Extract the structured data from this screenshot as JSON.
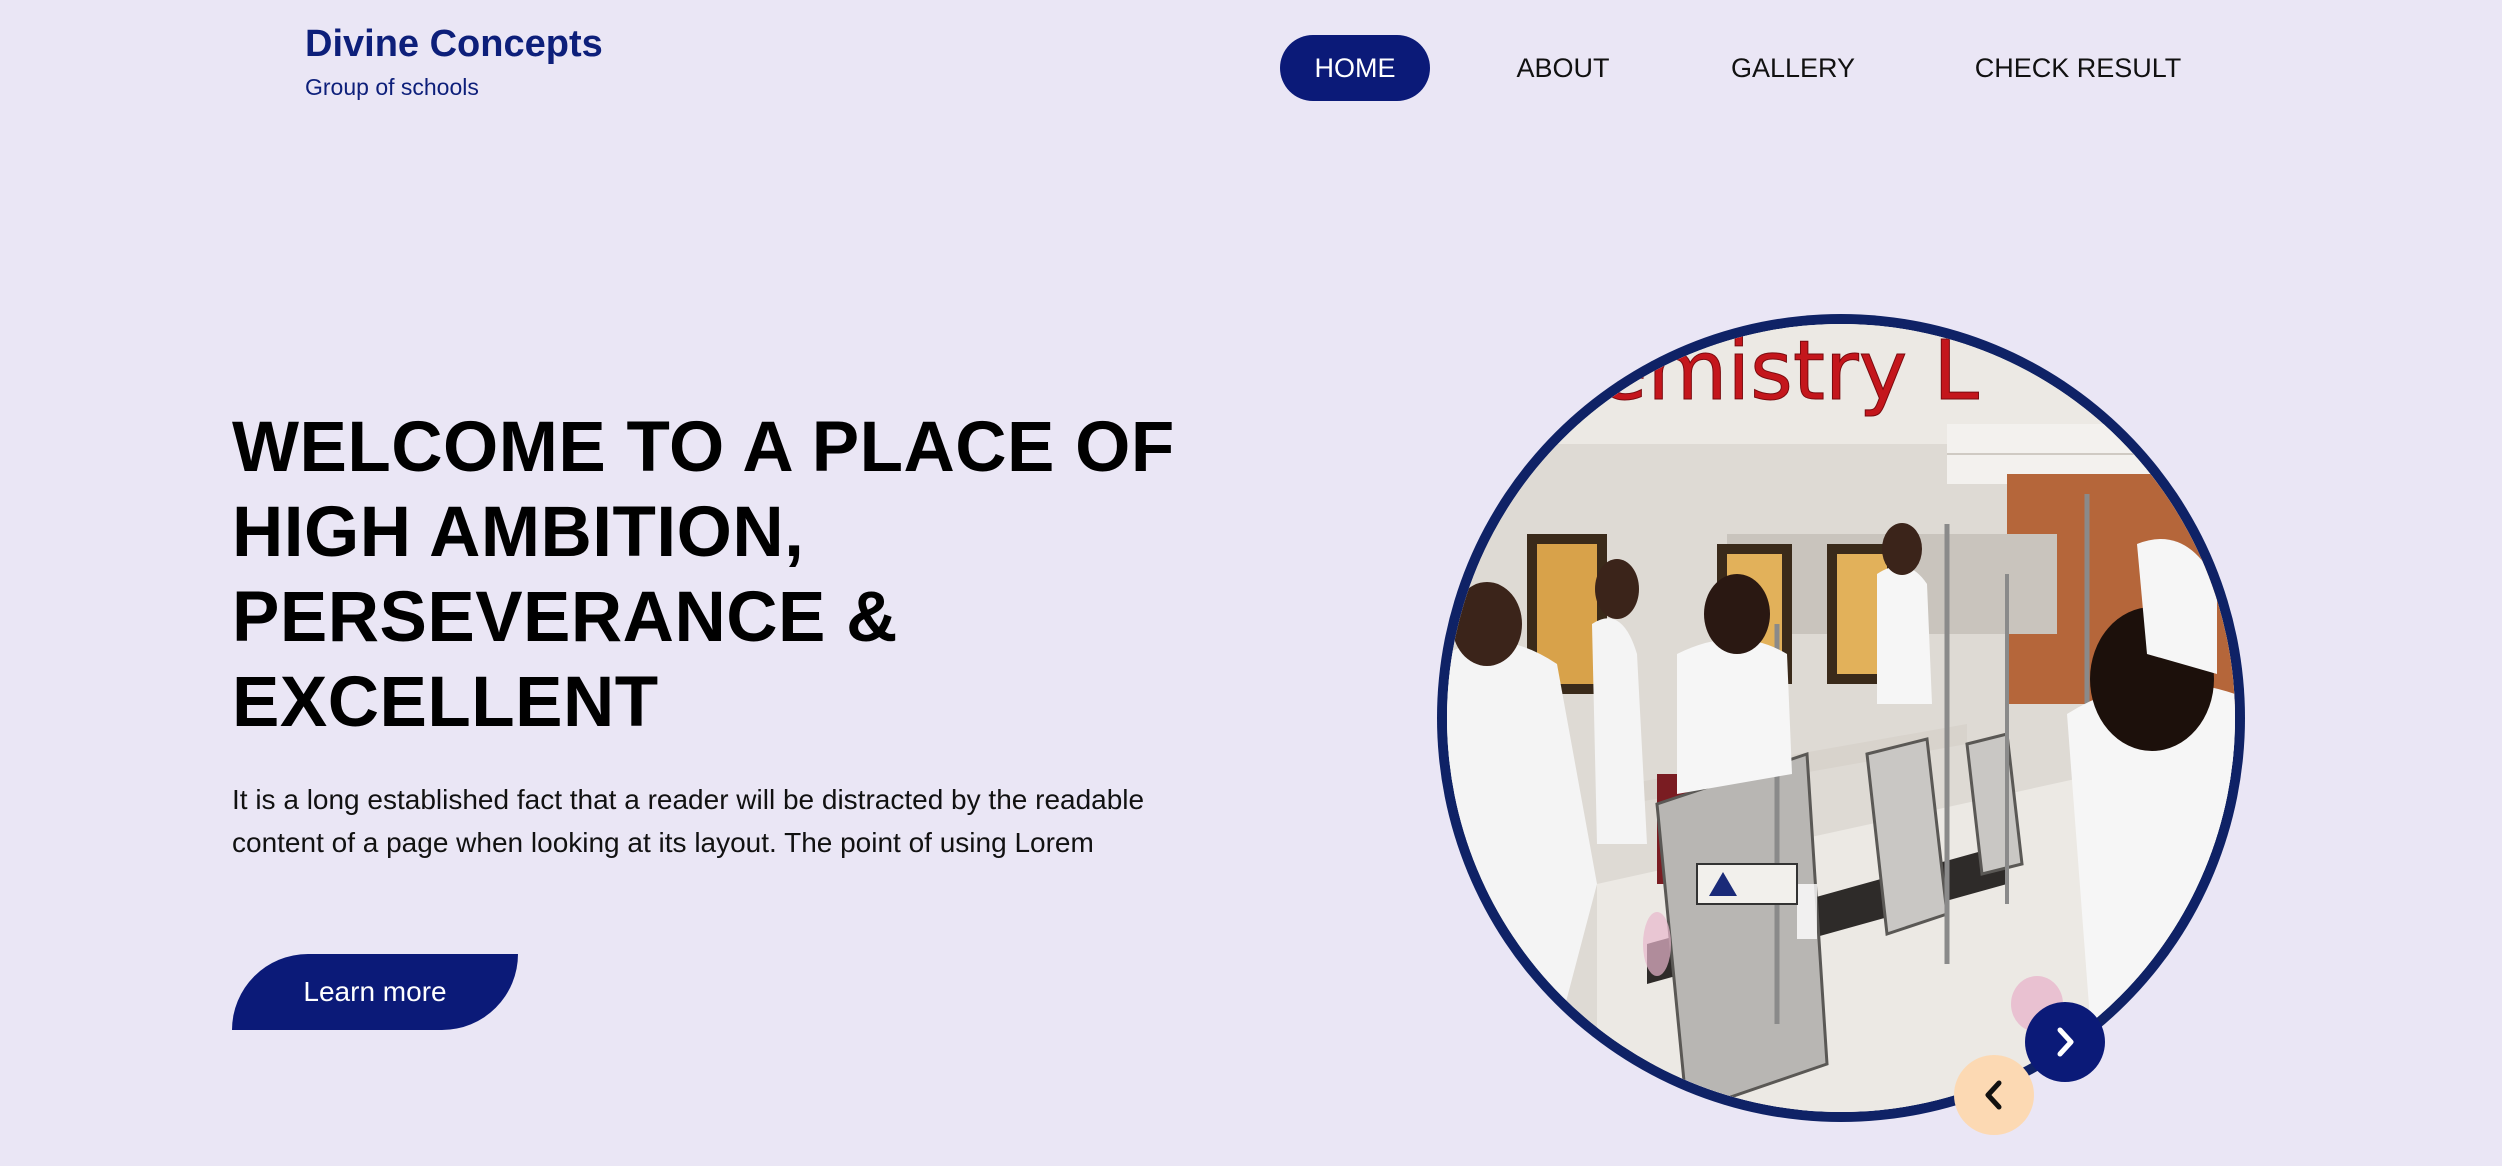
{
  "brand": {
    "title": "Divine Concepts",
    "subtitle": "Group of schools"
  },
  "nav": {
    "items": [
      {
        "label": "HOME",
        "active": true
      },
      {
        "label": "ABOUT",
        "active": false
      },
      {
        "label": "GALLERY",
        "active": false
      },
      {
        "label": "CHECK RESULT",
        "active": false
      }
    ]
  },
  "hero": {
    "title_lines": [
      "WELCOME TO A PLACE OF",
      "HIGH AMBITION,",
      "PERSEVERANCE &",
      "EXCELLENT"
    ],
    "text_lines": [
      "It is a long established fact that a reader will be distracted by the readable",
      "content of a page when looking at its layout. The point of using Lorem"
    ],
    "button_label": "Learn more"
  },
  "slider": {
    "image_caption": "emistry L",
    "image_subject": "students in white lab coats at chemistry lab benches",
    "next_icon": "chevron-right-icon",
    "prev_icon": "chevron-left-icon"
  },
  "colors": {
    "background": "#eae6f5",
    "primary": "#0b1a78",
    "accent": "#fcd9b3",
    "brand_text": "#0d1f7a"
  }
}
